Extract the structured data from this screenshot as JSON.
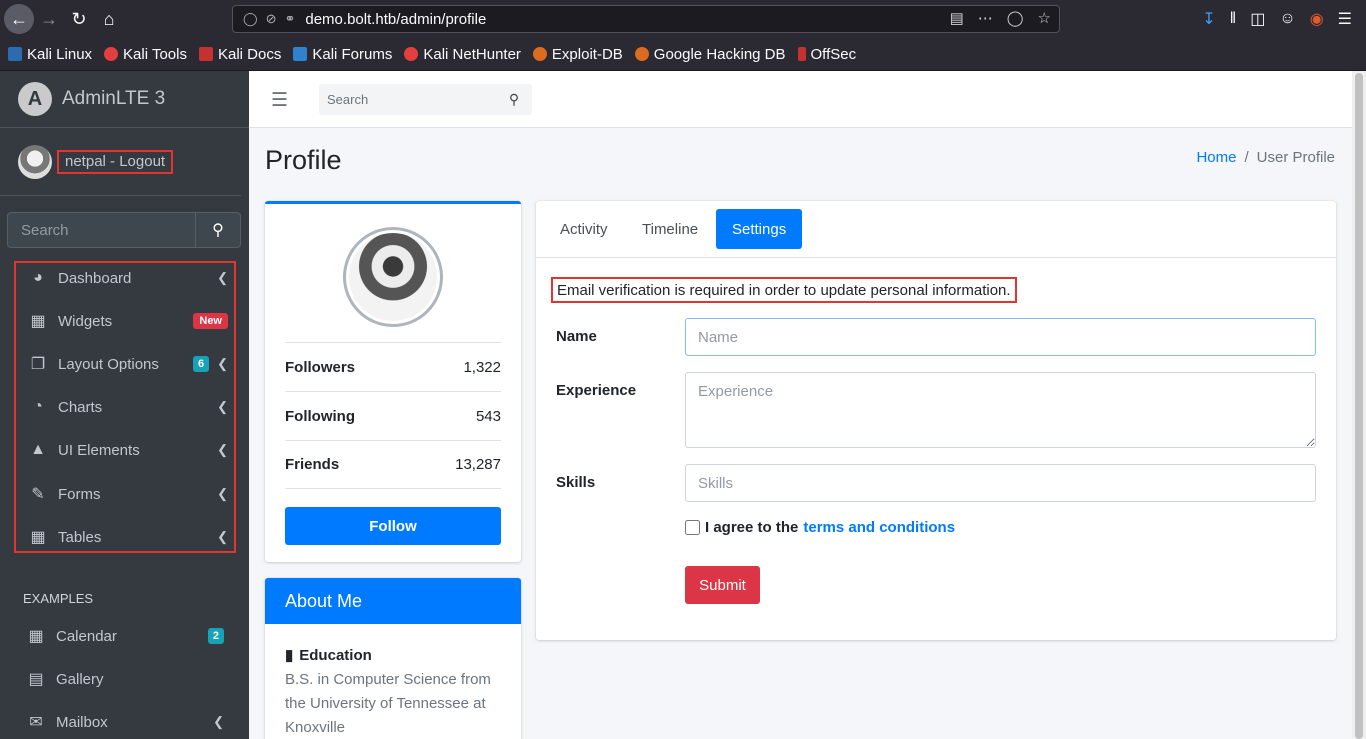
{
  "browser": {
    "url": "demo.bolt.htb/admin/profile",
    "bookmarks": [
      {
        "label": "Kali Linux",
        "color": "#2b6cb0"
      },
      {
        "label": "Kali Tools",
        "color": "#e53e3e"
      },
      {
        "label": "Kali Docs",
        "color": "#c53030"
      },
      {
        "label": "Kali Forums",
        "color": "#3182ce"
      },
      {
        "label": "Kali NetHunter",
        "color": "#e53e3e"
      },
      {
        "label": "Exploit-DB",
        "color": "#dd6b20"
      },
      {
        "label": "Google Hacking DB",
        "color": "#dd6b20"
      },
      {
        "label": "OffSec",
        "color": "#c53030"
      }
    ]
  },
  "sidebar": {
    "brand": "AdminLTE 3",
    "user_name": "netpal - Logout",
    "search_placeholder": "Search",
    "items": [
      {
        "label": "Dashboard",
        "icon": "dashboard-icon"
      },
      {
        "label": "Widgets",
        "icon": "widgets-icon",
        "badge": "New"
      },
      {
        "label": "Layout Options",
        "icon": "layout-icon",
        "badge": "6"
      },
      {
        "label": "Charts",
        "icon": "pie-chart-icon"
      },
      {
        "label": "UI Elements",
        "icon": "tree-icon"
      },
      {
        "label": "Forms",
        "icon": "edit-icon"
      },
      {
        "label": "Tables",
        "icon": "table-icon"
      }
    ],
    "examples_header": "EXAMPLES",
    "examples": [
      {
        "label": "Calendar",
        "icon": "calendar-icon",
        "badge": "2"
      },
      {
        "label": "Gallery",
        "icon": "image-icon"
      },
      {
        "label": "Mailbox",
        "icon": "envelope-icon"
      }
    ]
  },
  "topnav": {
    "search_placeholder": "Search"
  },
  "page": {
    "title": "Profile",
    "breadcrumb": {
      "home": "Home",
      "current": "User Profile",
      "separator": "/"
    }
  },
  "profile": {
    "stats": [
      {
        "label": "Followers",
        "value": "1,322"
      },
      {
        "label": "Following",
        "value": "543"
      },
      {
        "label": "Friends",
        "value": "13,287"
      }
    ],
    "follow_label": "Follow"
  },
  "about": {
    "title": "About Me",
    "education_label": "Education",
    "education_text": "B.S. in Computer Science from the University of Tennessee at Knoxville"
  },
  "settings": {
    "tabs": [
      "Activity",
      "Timeline",
      "Settings"
    ],
    "active_tab": "Settings",
    "notice": "Email verification is required in order to update personal information.",
    "name_label": "Name",
    "name_placeholder": "Name",
    "experience_label": "Experience",
    "experience_placeholder": "Experience",
    "skills_label": "Skills",
    "skills_placeholder": "Skills",
    "agree_text": "I agree to the",
    "terms_text": "terms and conditions",
    "submit_label": "Submit"
  },
  "colors": {
    "primary": "#007bff",
    "danger": "#dc3545",
    "sidebar_bg": "#343a40",
    "highlight": "#e3342f"
  }
}
